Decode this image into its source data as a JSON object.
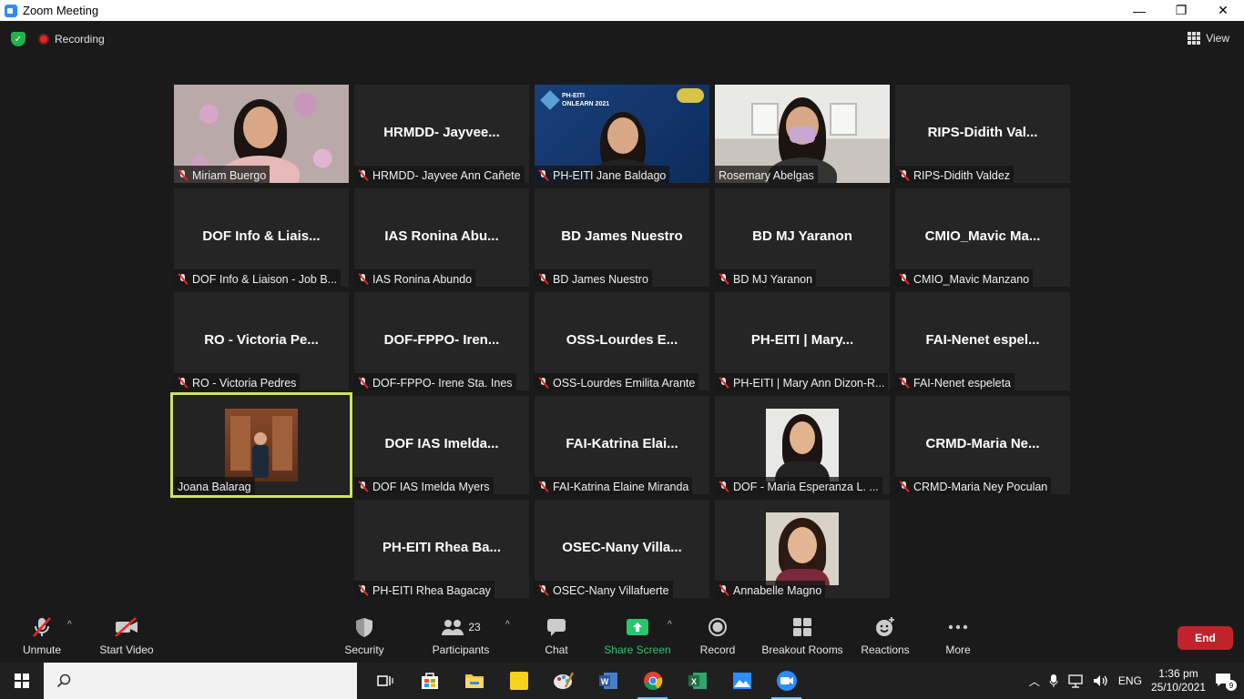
{
  "window": {
    "title": "Zoom Meeting",
    "minimize": "—",
    "restore": "❐",
    "close": "✕"
  },
  "top": {
    "recording": "Recording",
    "view": "View"
  },
  "tiles": [
    {
      "label": "Miriam Buergo",
      "big": ""
    },
    {
      "label": "HRMDD- Jayvee Ann Cañete",
      "big": "HRMDD-  Jayvee..."
    },
    {
      "label": "PH-EITI Jane Baldago",
      "big": ""
    },
    {
      "label": "Rosemary Abelgas",
      "big": ""
    },
    {
      "label": "RIPS-Didith Valdez",
      "big": "RIPS-Didith  Val..."
    },
    {
      "label": "DOF Info & Liaison - Job B...",
      "big": "DOF  Info  &  Liais..."
    },
    {
      "label": "IAS Ronina Abundo",
      "big": "IAS  Ronina  Abu..."
    },
    {
      "label": "BD James Nuestro",
      "big": "BD  James  Nuestro"
    },
    {
      "label": "BD MJ Yaranon",
      "big": "BD  MJ  Yaranon"
    },
    {
      "label": "CMIO_Mavic Manzano",
      "big": "CMIO_Mavic  Ma..."
    },
    {
      "label": "RO - Victoria Pedres",
      "big": "RO  -  Victoria  Pe..."
    },
    {
      "label": "DOF-FPPO- Irene Sta. Ines",
      "big": "DOF-FPPO-  Iren..."
    },
    {
      "label": "OSS-Lourdes Emilita Arante",
      "big": "OSS-Lourdes  E..."
    },
    {
      "label": "PH-EITI | Mary Ann Dizon-R...",
      "big": "PH-EITI  |  Mary..."
    },
    {
      "label": "FAI-Nenet espeleta",
      "big": "FAI-Nenet  espel..."
    },
    {
      "label": "Joana Balarag",
      "big": ""
    },
    {
      "label": "DOF IAS Imelda Myers",
      "big": "DOF  IAS  Imelda..."
    },
    {
      "label": "FAI-Katrina Elaine Miranda",
      "big": "FAI-Katrina  Elai..."
    },
    {
      "label": "DOF - Maria Esperanza L. ...",
      "big": ""
    },
    {
      "label": "CRMD-Maria Ney Poculan",
      "big": "CRMD-Maria  Ne..."
    },
    {
      "label": "PH-EITI Rhea Bagacay",
      "big": "PH-EITI  Rhea  Ba..."
    },
    {
      "label": "OSEC-Nany Villafuerte",
      "big": "OSEC-Nany  Villa..."
    },
    {
      "label": "Annabelle Magno",
      "big": ""
    }
  ],
  "slide": {
    "line1": "PH-EITI",
    "line2": "ONLEARN 2021"
  },
  "toolbar": {
    "unmute": "Unmute",
    "start_video": "Start Video",
    "security": "Security",
    "participants": "Participants",
    "participant_count": "23",
    "chat": "Chat",
    "share_screen": "Share Screen",
    "record": "Record",
    "breakout": "Breakout Rooms",
    "reactions": "Reactions",
    "more": "More",
    "end": "End"
  },
  "taskbar": {
    "time": "1:36 pm",
    "date": "25/10/2021",
    "lang": "ENG",
    "notif": "9"
  },
  "colors": {
    "active_speaker": "#cfe35f",
    "end": "#c0232c",
    "share": "#28c76f"
  }
}
